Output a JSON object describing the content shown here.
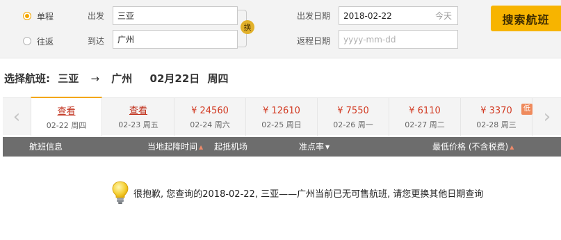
{
  "search": {
    "trip_types": [
      {
        "label": "单程",
        "selected": true
      },
      {
        "label": "往返",
        "selected": false
      }
    ],
    "from_label": "出发",
    "from_value": "三亚",
    "to_label": "到达",
    "to_value": "广州",
    "swap_label": "换",
    "depart_label": "出发日期",
    "depart_value": "2018-02-22",
    "depart_hint": "今天",
    "return_label": "返程日期",
    "return_placeholder": "yyyy-mm-dd",
    "button_label": "搜索航班"
  },
  "route": {
    "prefix": "选择航班:",
    "from": "三亚",
    "arrow": "→",
    "to": "广州",
    "date": "02月22日",
    "weekday": "周四"
  },
  "date_tabs": [
    {
      "price": "查看",
      "date": "02-22 周四",
      "active": true
    },
    {
      "price": "查看",
      "date": "02-23 周五",
      "active": false
    },
    {
      "price": "¥ 24560",
      "date": "02-24 周六",
      "active": false
    },
    {
      "price": "¥ 12610",
      "date": "02-25 周日",
      "active": false
    },
    {
      "price": "¥ 7550",
      "date": "02-26 周一",
      "active": false
    },
    {
      "price": "¥ 6110",
      "date": "02-27 周二",
      "active": false
    },
    {
      "price": "¥ 3370",
      "date": "02-28 周三",
      "active": false
    }
  ],
  "low_badge": "低",
  "columns": {
    "flight_info": "航班信息",
    "local_time": "当地起降时间",
    "airport": "起抵机场",
    "on_time": "准点率",
    "lowest_price": "最低价格 (不含税费)"
  },
  "empty_message": "很抱歉, 您查询的2018-02-22, 三亚——广州当前已无可售航班, 请您更换其他日期查询",
  "colors": {
    "accent": "#f7b400",
    "price_red": "#d23a22",
    "header_gray": "#6d6d6d"
  }
}
